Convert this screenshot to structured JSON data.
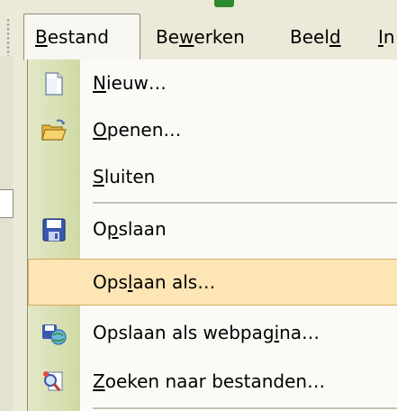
{
  "menubar": {
    "items": [
      {
        "pre": "",
        "ul": "B",
        "post": "estand"
      },
      {
        "pre": "Be",
        "ul": "w",
        "post": "erken"
      },
      {
        "pre": "Beel",
        "ul": "d",
        "post": ""
      },
      {
        "pre": "",
        "ul": "I",
        "post": "n"
      }
    ]
  },
  "menu": {
    "items": [
      {
        "pre": "",
        "ul": "N",
        "post": "ieuw…",
        "icon": "new-document-icon"
      },
      {
        "pre": "",
        "ul": "O",
        "post": "penen…",
        "icon": "open-folder-icon"
      },
      {
        "pre": "",
        "ul": "S",
        "post": "luiten",
        "icon": ""
      },
      {
        "pre": "O",
        "ul": "p",
        "post": "slaan",
        "icon": "save-disk-icon"
      },
      {
        "pre": "Ops",
        "ul": "l",
        "post": "aan als…",
        "icon": "",
        "highlighted": true
      },
      {
        "pre": "Opslaan als webpag",
        "ul": "i",
        "post": "na…",
        "icon": "save-as-webpage-icon"
      },
      {
        "pre": "",
        "ul": "Z",
        "post": "oeken naar bestanden…",
        "icon": "search-files-icon"
      }
    ]
  },
  "colors": {
    "highlight": "#fde5b5",
    "icon_column": "#d0daa5",
    "window_background": "#ece9d8"
  }
}
